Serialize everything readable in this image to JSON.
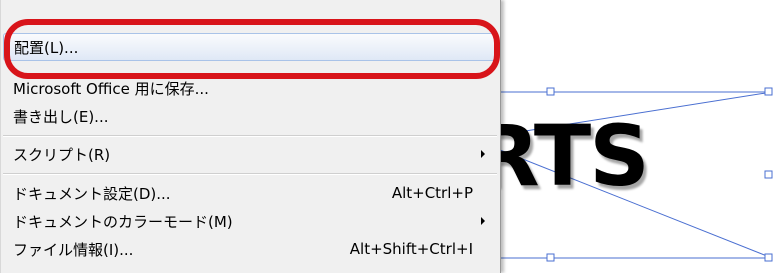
{
  "colors": {
    "menu_bg": "#f0f0f0",
    "highlight_ring": "#d8141a",
    "selection_line": "#4a6fd1",
    "hover_item_border": "#a9c3e8"
  },
  "menu": {
    "items": [
      {
        "label": "配置(L)...",
        "shortcut": "",
        "submenu": false,
        "highlighted": true
      },
      {
        "label": "Microsoft Office 用に保存...",
        "shortcut": "",
        "submenu": false
      },
      {
        "label": "書き出し(E)...",
        "shortcut": "",
        "submenu": false
      },
      {
        "label": "スクリプト(R)",
        "shortcut": "",
        "submenu": true
      },
      {
        "label": "ドキュメント設定(D)...",
        "shortcut": "Alt+Ctrl+P",
        "submenu": false
      },
      {
        "label": "ドキュメントのカラーモード(M)",
        "shortcut": "",
        "submenu": true
      },
      {
        "label": "ファイル情報(I)...",
        "shortcut": "Alt+Shift+Ctrl+I",
        "submenu": false
      }
    ]
  },
  "artboard": {
    "placed_text": "RTS",
    "selection_handle_icon": "square-handle-icon",
    "submenu_arrow_icon": "triangle-right-icon"
  }
}
